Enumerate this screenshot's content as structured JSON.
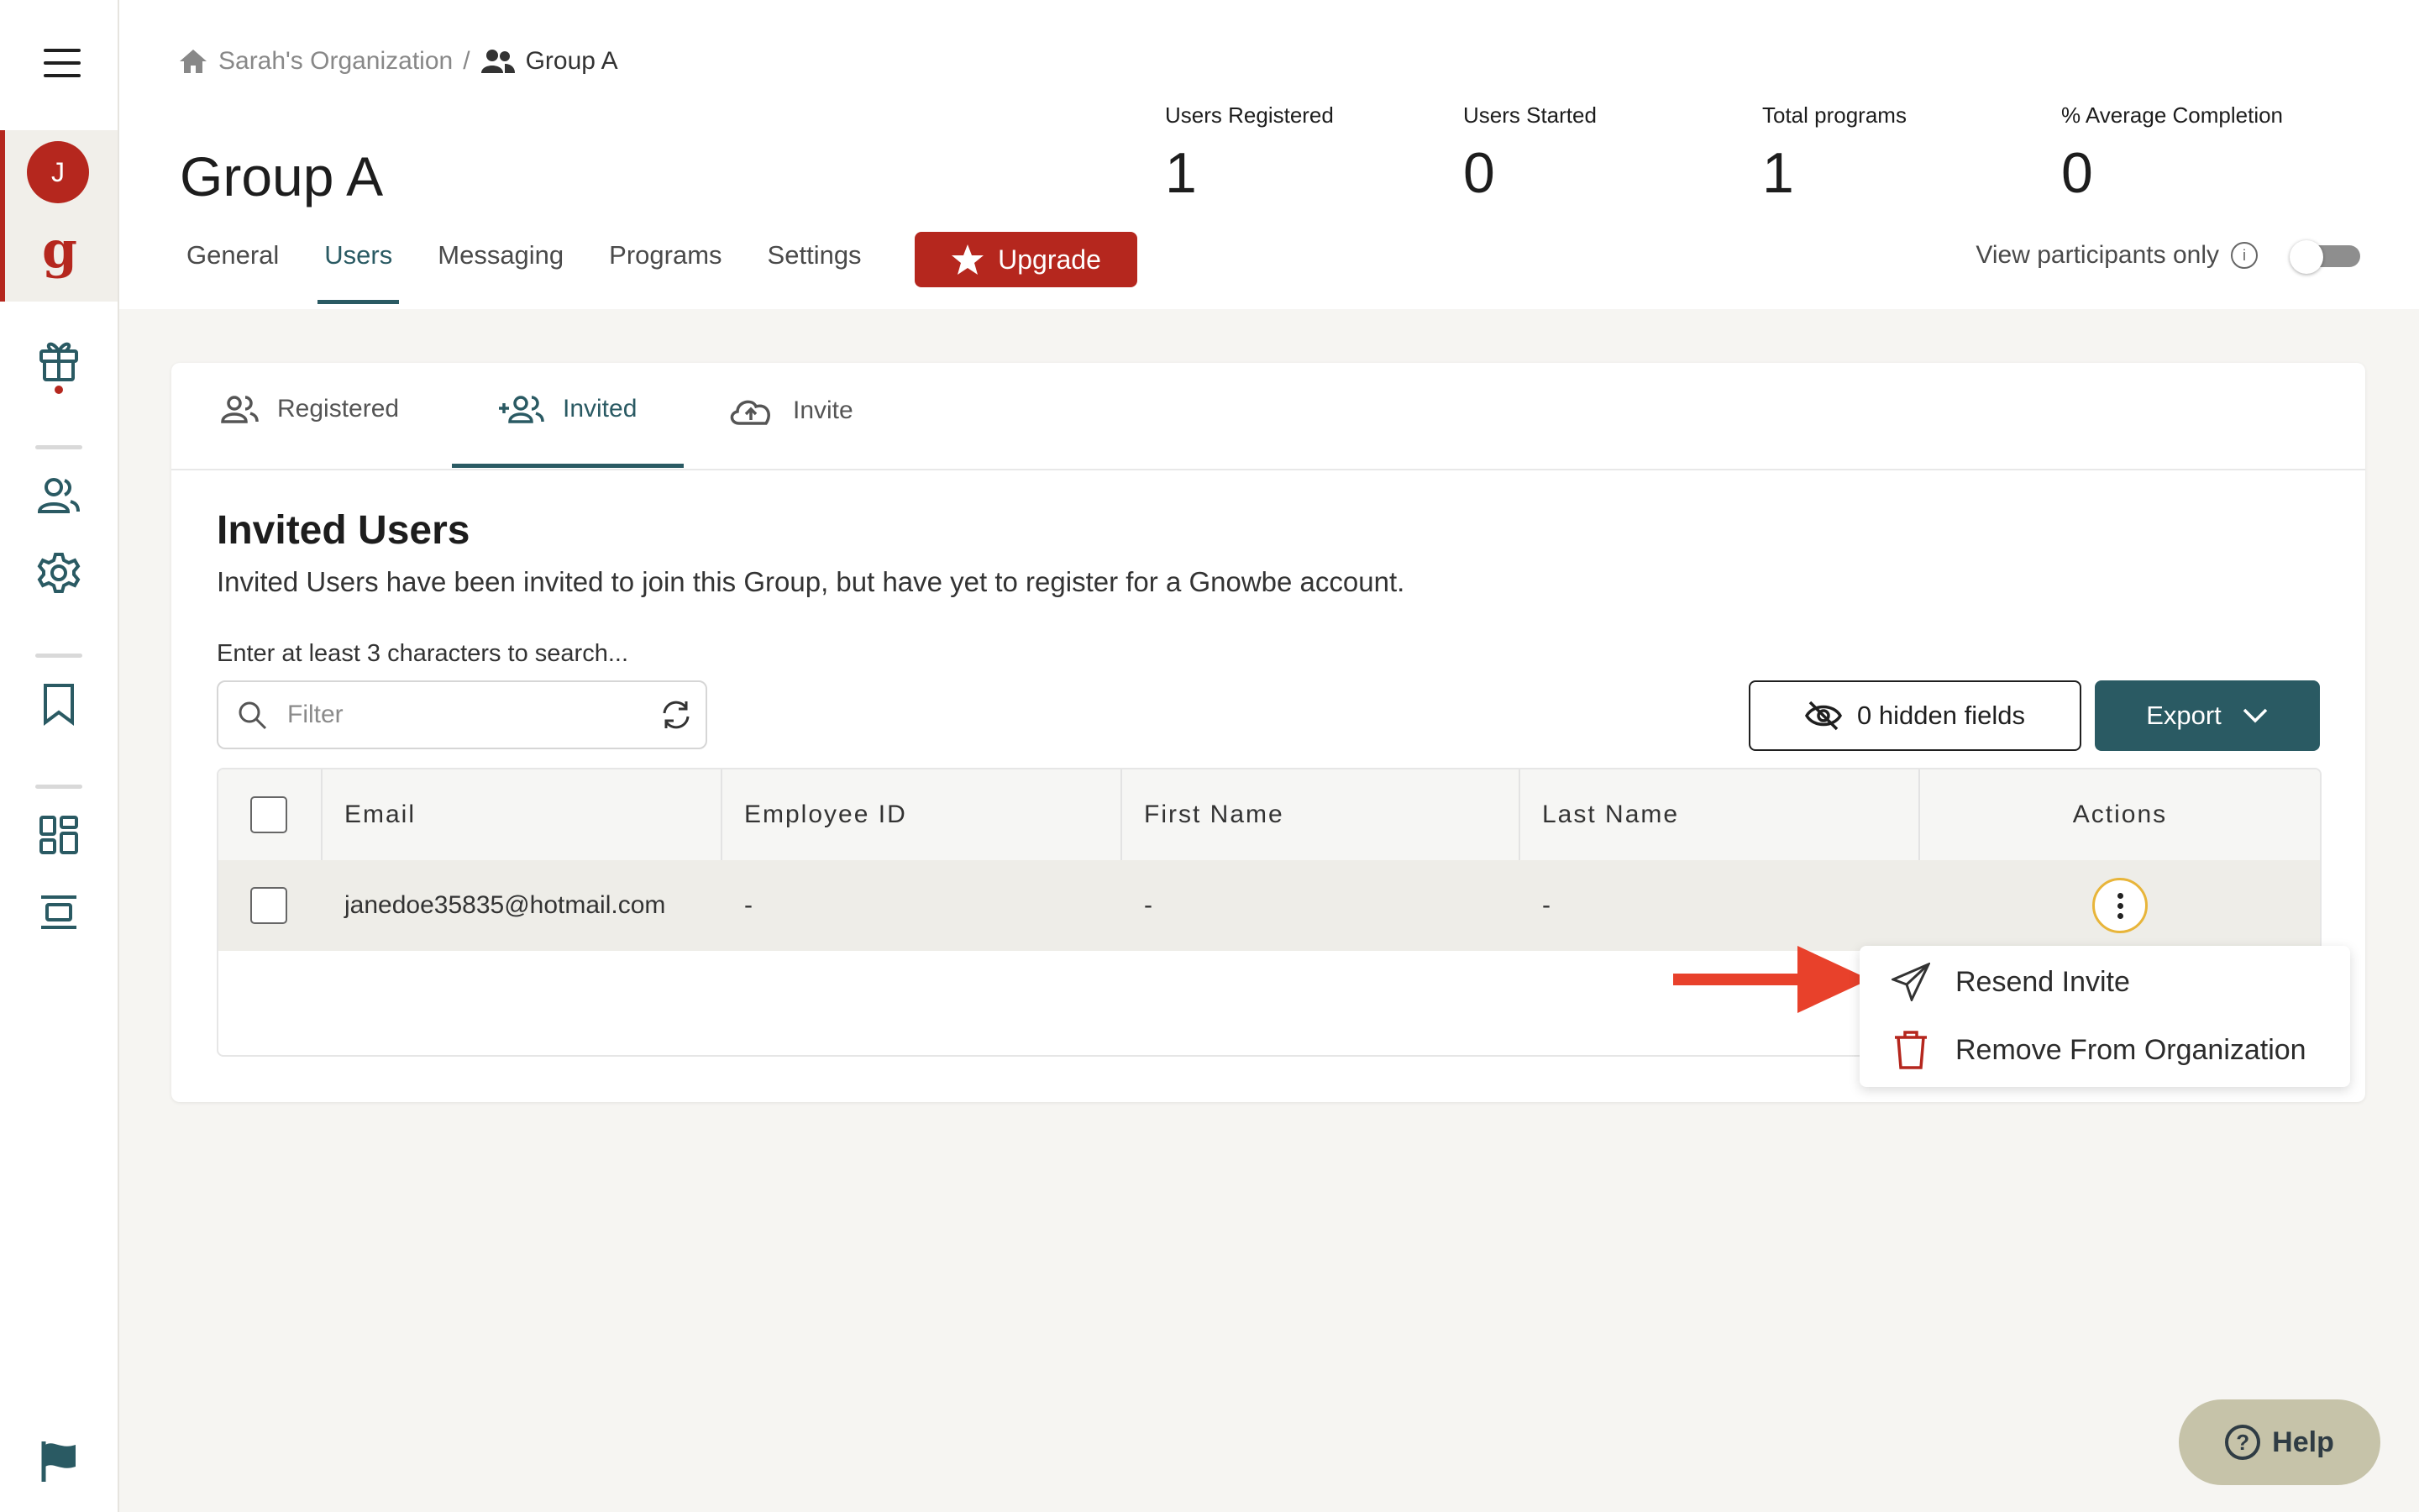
{
  "breadcrumb": {
    "org": "Sarah's Organization",
    "separator": "/",
    "group": "Group A"
  },
  "page_title": "Group A",
  "stats": [
    {
      "label": "Users Registered",
      "value": "1"
    },
    {
      "label": "Users Started",
      "value": "0"
    },
    {
      "label": "Total programs",
      "value": "1"
    },
    {
      "label": "% Average Completion",
      "value": "0"
    }
  ],
  "tabs": [
    "General",
    "Users",
    "Messaging",
    "Programs",
    "Settings"
  ],
  "active_tab": "Users",
  "upgrade_label": "Upgrade",
  "view_participants": {
    "label": "View participants only",
    "on": false
  },
  "rail": {
    "avatar_initial": "J",
    "logo": "g"
  },
  "subtabs": [
    "Registered",
    "Invited",
    "Invite"
  ],
  "active_subtab": "Invited",
  "section": {
    "title": "Invited Users",
    "description": "Invited Users have been invited to join this Group, but have yet to register for a Gnowbe account.",
    "search_hint": "Enter at least 3 characters to search...",
    "filter_placeholder": "Filter"
  },
  "hidden_fields_label": "0 hidden fields",
  "export_label": "Export",
  "table": {
    "columns": [
      "Email",
      "Employee ID",
      "First Name",
      "Last Name",
      "Actions"
    ],
    "rows": [
      {
        "email": "janedoe35835@hotmail.com",
        "employee_id": "-",
        "first_name": "-",
        "last_name": "-"
      }
    ]
  },
  "menu": {
    "resend": "Resend Invite",
    "remove": "Remove From Organization"
  },
  "help_label": "Help",
  "colors": {
    "brand_red": "#b5271e",
    "teal": "#2a5a63",
    "arrow_red": "#e8412b"
  }
}
